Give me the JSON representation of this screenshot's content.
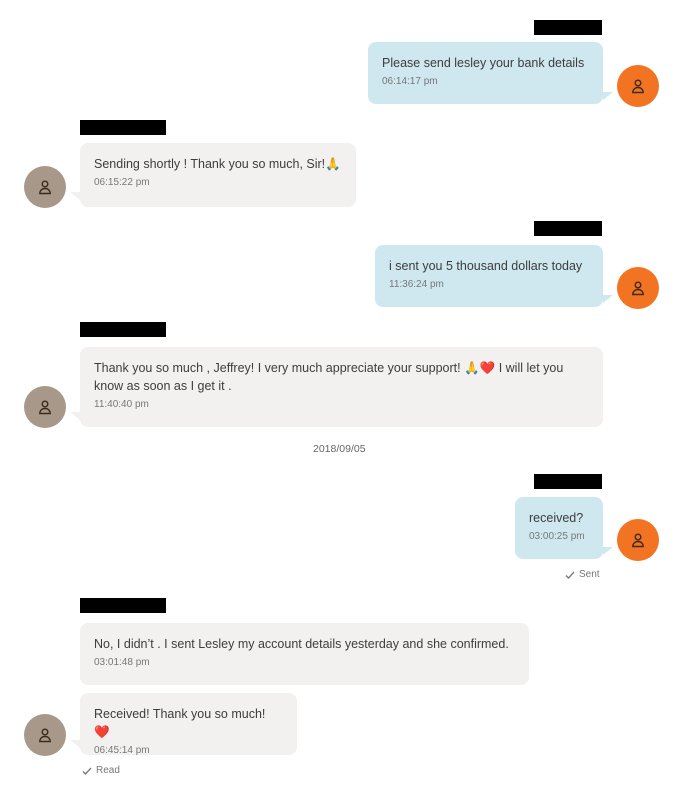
{
  "messages": [
    {
      "text": "Please send lesley your bank details",
      "time": "06:14:17 pm"
    },
    {
      "text": "Sending shortly ! Thank you so much, Sir!",
      "emoji": "🙏",
      "time": "06:15:22 pm"
    },
    {
      "text": "i sent you 5 thousand dollars today",
      "time": "11:36:24 pm"
    },
    {
      "text": "Thank you so much , Jeffrey! I very much appreciate your support! ",
      "emoji": "🙏❤️",
      "text_after": " I will let you know as soon as I get it .",
      "time": "11:40:40 pm"
    },
    {
      "text": "received?",
      "time": "03:00:25 pm"
    },
    {
      "text": "No, I didn’t . I sent Lesley my account details yesterday and she confirmed.",
      "time": "03:01:48 pm"
    },
    {
      "text": "Received! Thank you so much! ",
      "emoji": "❤️",
      "time": "06:45:14 pm"
    }
  ],
  "date_separator": "2018/09/05",
  "status": {
    "sent": "Sent",
    "read": "Read"
  },
  "colors": {
    "outgoing_bubble": "#cfe7ef",
    "incoming_bubble": "#f2f1ef",
    "outgoing_avatar": "#f27423",
    "incoming_avatar": "#a8988a"
  },
  "icons": {
    "avatar": "person-icon",
    "check": "checkmark-icon"
  }
}
